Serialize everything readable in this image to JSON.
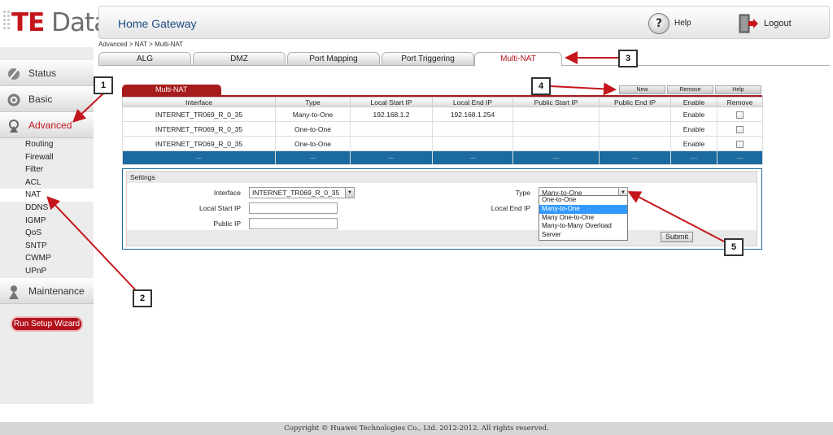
{
  "logo": {
    "te": "TE",
    "data": " Data"
  },
  "header": {
    "title": "Home Gateway",
    "help_label": "Help",
    "logout_label": "Logout"
  },
  "breadcrumb": "Advanced > NAT > Multi-NAT",
  "sidebar": {
    "main": [
      {
        "label": "Status",
        "icon": "status-icon"
      },
      {
        "label": "Basic",
        "icon": "basic-gear-icon"
      },
      {
        "label": "Advanced",
        "icon": "advanced-icon"
      },
      {
        "label": "Maintenance",
        "icon": "maintenance-icon"
      }
    ],
    "sub": [
      "Routing",
      "Firewall",
      "Filter",
      "ACL",
      "NAT",
      "DDNS",
      "IGMP",
      "QoS",
      "SNTP",
      "CWMP",
      "UPnP"
    ],
    "wizard": "Run Setup Wizard"
  },
  "tabs": [
    "ALG",
    "DMZ",
    "Port Mapping",
    "Port Triggering",
    "Multi-NAT"
  ],
  "panel": {
    "title": "Multi-NAT",
    "buttons": {
      "new": "New",
      "remove": "Remove",
      "help": "Help"
    },
    "columns": [
      "Interface",
      "Type",
      "Local Start IP",
      "Local End IP",
      "Public Start IP",
      "Public End IP",
      "Enable",
      "Remove"
    ],
    "rows": [
      [
        "INTERNET_TR069_R_0_35",
        "Many-to-One",
        "192.168.1.2",
        "192.168.1.254",
        "",
        "",
        "Enable"
      ],
      [
        "INTERNET_TR069_R_0_35",
        "One-to-One",
        "",
        "",
        "",
        "",
        "Enable"
      ],
      [
        "INTERNET_TR069_R_0_35",
        "One-to-One",
        "",
        "",
        "",
        "",
        "Enable"
      ]
    ],
    "blank_row": [
      "—",
      "—",
      "—",
      "—",
      "—",
      "—",
      "—",
      "—"
    ]
  },
  "settings": {
    "title": "Settings",
    "interface_label": "Interface",
    "interface_value": "INTERNET_TR069_R_0_35",
    "type_label": "Type",
    "type_value": "Many-to-One",
    "local_start_label": "Local Start IP",
    "local_end_label": "Local End IP",
    "public_ip_label": "Public IP",
    "type_options": [
      "One-to-One",
      "Many-to-One",
      "Many One-to-One",
      "Many-to-Many Overload",
      "Server"
    ],
    "submit": "Submit"
  },
  "callouts": [
    "1",
    "2",
    "3",
    "4",
    "5"
  ],
  "footer": "Copyright © Huawei Technologies Co., Ltd. 2012-2012. All rights reserved.",
  "colors": {
    "brand_red": "#c4161c",
    "tab_red": "#a61b1b",
    "row_blue": "#1b6aa0",
    "title_blue": "#1d4a82",
    "select_blue": "#3399ff"
  }
}
